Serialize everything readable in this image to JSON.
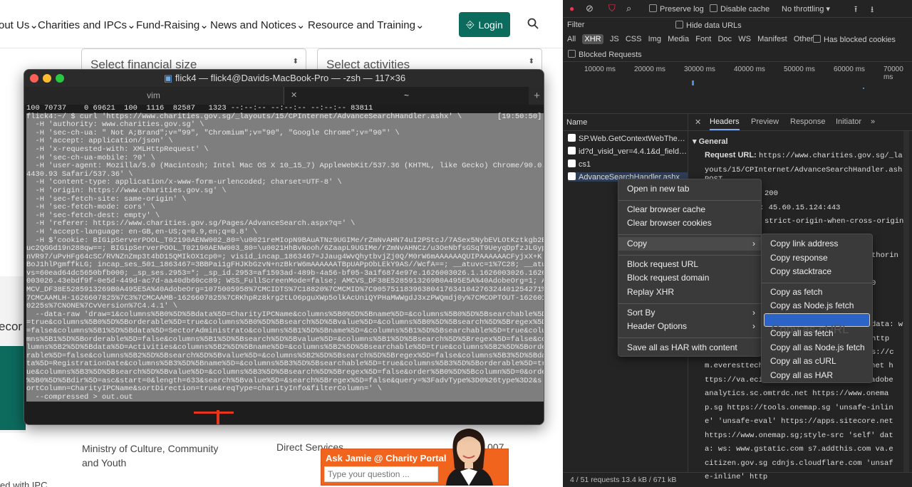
{
  "website": {
    "nav": [
      "out Us",
      "Charities and IPCs",
      "Fund-Raising",
      "News and Notices",
      "Resource and Training"
    ],
    "login_label": "Login",
    "select_financial": "Select financial size",
    "select_activities": "Select activities",
    "side_text_1": "ecor",
    "side_text_2": "Ministry of Culture, Community and Youth",
    "side_text_3": "Direct Services",
    "side_text_4": "007",
    "side_text_5": "ed with IPC",
    "chat_title": "Ask Jamie @ Charity Portal",
    "chat_placeholder": "Type your question ..."
  },
  "terminal": {
    "title": "flick4 — flick4@Davids-MacBook-Pro — -zsh — 117×36",
    "tabs": [
      "vim",
      "~"
    ],
    "lines": [
      "100 70737    0 69621  100  1116  82587   1323 --:--:-- --:--:-- --:--:-- 83811",
      "flick4:~/ $ curl 'https://www.charities.gov.sg/_layouts/15/CPInternet/AdvanceSearchHandler.ashx' \\        [19:50:50]",
      "  -H 'authority: www.charities.gov.sg' \\",
      "  -H 'sec-ch-ua: \" Not A;Brand\";v=\"99\", \"Chromium\";v=\"90\", \"Google Chrome\";v=\"90\"' \\",
      "  -H 'accept: application/json' \\",
      "  -H 'x-requested-with: XMLHttpRequest' \\",
      "  -H 'sec-ch-ua-mobile: ?0' \\",
      "  -H 'user-agent: Mozilla/5.0 (Macintosh; Intel Mac OS X 10_15_7) AppleWebKit/537.36 (KHTML, like Gecko) Chrome/90.0.",
      "4430.93 Safari/537.36' \\",
      "  -H 'content-type: application/x-www-form-urlencoded; charset=UTF-8' \\",
      "  -H 'origin: https://www.charities.gov.sg' \\",
      "  -H 'sec-fetch-site: same-origin' \\",
      "  -H 'sec-fetch-mode: cors' \\",
      "  -H 'sec-fetch-dest: empty' \\",
      "  -H 'referer: https://www.charities.gov.sg/Pages/AdvanceSearch.aspx?q=' \\",
      "  -H 'accept-language: en-GB,en-US;q=0.9,en;q=0.8' \\",
      "  -H $'cookie: BIGipServerPOOL_T02190AENW002_80=\\u0021reMIopN9BAuATNz9UGIMe/rZmNvAHN74uI2PStcJ/7ASex5NybEVLOtKztkgb2E",
      "uc2QGGd19n288qw==; BIGipServerPOOL_T02190AENW003_80=\\u0021HhBvNooh/6ZaapL9UGIMe/rZmNvAHNCz/u3OeNbfsGSqT9UeyqDpfzJLGyp",
      "nVR97/uPvHFg64cSC/RVNZnZmp3t4bD15QMIkOX1cp0=; visid_incap_1863467=JJaug4WvQhytbvjZj0Q/M0rW6mAAAAAAQUIPAAAAAACFyjxX+K",
      "BoJ1hlPgmffkLG; incap_ses_501_1863467=3BBPai1gFHJKbGzvN+nzBkrW6mAAAAAATBpUAPpObLEkY9AS//WcfA==; __atuvc=1%7C28; __atu",
      "vs=60ead64dc5650bfb000; _sp_ses.2953=*; _sp_id.2953=af1593ad-489b-4a56-bf05-3a1f6874e97e.1626003026.1.1626003026.1626",
      "003026.43ebdf9f-0e5d-449d-ac7d-aa40db60cc89; WSS_FullScreenMode=false; AMCVS_DF38E5285913269B0A495E5A%40AdobeOrg=1; A",
      "MCV_DF38E5285913269B0A495E5A%40AdobeOrg=1075005958%7CMCIDTS%7C18820%7CMCMID%7C90575118396380417634104276324401254271%",
      "7CMCAAMLH-1626607825%7C3%7CMCAAMB-1626607825%7CRKhpRz8krg2tLO6pguXWp5olkAcUniQYPHaMWWgdJ3xzPWQmdj0y%7CMCOPTOUT-162601",
      "0225s%7CNONE%7CvVersion%7C4.4.1' \\",
      "  --data-raw 'draw=1&columns%5B0%5D%5Bdata%5D=CharityIPCName&columns%5B0%5D%5Bname%5D=&columns%5B0%5D%5Bsearchable%5D",
      "=true&columns%5B0%5D%5Borderable%5D=true&columns%5B0%5D%5Bsearch%5D%5Bvalue%5D=&columns%5B0%5D%5Bsearch%5D%5Bregex%5D",
      "=false&columns%5B1%5D%5Bdata%5D=SectorAdministrato&columns%5B1%5D%5Bname%5D=&columns%5B1%5D%5Bsearchable%5D=true&colu",
      "mns%5B1%5D%5Borderable%5D=false&columns%5B1%5D%5Bsearch%5D%5Bvalue%5D=&columns%5B1%5D%5Bsearch%5D%5Bregex%5D=false&co",
      "lumns%5B2%5D%5Bdata%5D=Activities&columns%5B2%5D%5Bname%5D=&columns%5B2%5D%5Bsearchable%5D=true&columns%5B2%5D%5Borde",
      "rable%5D=false&columns%5B2%5D%5Bsearch%5D%5Bvalue%5D=&columns%5B2%5D%5Bsearch%5D%5Bregex%5D=false&columns%5B3%5D%5Bda",
      "ta%5D=RegistrationDate&columns%5B3%5D%5Bname%5D=&columns%5B3%5D%5Bsearchable%5D=true&columns%5B3%5D%5Borderable%5D=tr",
      "ue&columns%5B3%5D%5Bsearch%5D%5Bvalue%5D=&columns%5B3%5D%5Bsearch%5D%5Bregex%5D=false&order%5B0%5D%5Bcolumn%5D=0&order",
      "%5B0%5D%5Bdir%5D=asc&start=0&length=633&search%5Bvalue%5D=&search%5Bregex%5D=false&query=%3FadvType%3D0%26type%3D2&s",
      "ortColumn=CharityIPCName&sortDirection=true&reqType=charityInfo&filterColumn=' \\",
      "  --compressed > out.out"
    ]
  },
  "devtools": {
    "toolbar": {
      "preserve_log": "Preserve log",
      "disable_cache": "Disable cache",
      "throttling": "No throttling"
    },
    "filter_label": "Filter",
    "hide_data_urls": "Hide data URLs",
    "types": [
      "All",
      "XHR",
      "JS",
      "CSS",
      "Img",
      "Media",
      "Font",
      "Doc",
      "WS",
      "Manifest",
      "Other"
    ],
    "has_blocked_cookies": "Has blocked cookies",
    "blocked_requests": "Blocked Requests",
    "timeline_labels": [
      "10000 ms",
      "20000 ms",
      "30000 ms",
      "40000 ms",
      "50000 ms",
      "60000 ms",
      "70000 ms"
    ],
    "name_header": "Name",
    "requests": [
      "SP.Web.GetContextWebThe…",
      "id?d_visid_ver=4.4.1&d_field…",
      "cs1",
      "AdvanceSearchHandler.ashx"
    ],
    "detail_tabs": [
      "Headers",
      "Preview",
      "Response",
      "Initiator"
    ],
    "general_label": "General",
    "request_url_label": "Request URL:",
    "request_url_1": "https://www.charities.gov.sg/_layouts/15/CPInternet/AdvanceSearchHandler.ashx",
    "detail_lines": [
      "POST",
      "200",
      ": 45.60.15.124:443",
      "strict-origin-when-cross-origin",
      "",
      "thorin",
      "",
      "0",
      "",
      "",
      "data: w",
      "http",
      "s://c",
      "m.everesttech.net  https://dpm.demdex.net https://va.ecitizen.gov.sg https://wogadobeanalytics.sc.omtrdc.net https://www.onemap.sg https://tools.onemap.sg  'unsafe-inline' 'unsafe-eval' https://apps.sitecore.net https://www.onemap.sg;style-src 'self' data: ws: www.gstatic.com s7.addthis.com va.ecitizen.gov.sg cdnjs.cloudflare.com 'unsafe-inline' http"
    ],
    "status": "4 / 51 requests   13.4 kB / 671 kB"
  },
  "context_menu": {
    "items": [
      "Open in new tab",
      "Clear browser cache",
      "Clear browser cookies",
      "Copy",
      "Block request URL",
      "Block request domain",
      "Replay XHR",
      "Sort By",
      "Header Options",
      "Save all as HAR with content"
    ]
  },
  "copy_submenu": {
    "items": [
      "Copy link address",
      "Copy response",
      "Copy stacktrace",
      "Copy as fetch",
      "Copy as Node.js fetch",
      "Copy as cURL",
      "Copy all as fetch",
      "Copy all as Node.js fetch",
      "Copy all as cURL",
      "Copy all as HAR"
    ],
    "selected": "Copy as cURL"
  },
  "colors": {
    "terminal_bg": "#1d1d1d",
    "highlight": "#7e7e7e",
    "login_bg": "#0b6b5d",
    "menu_selected": "#2b63c6",
    "arrow": "#e8361c",
    "chat_bg": "#f0641e"
  }
}
